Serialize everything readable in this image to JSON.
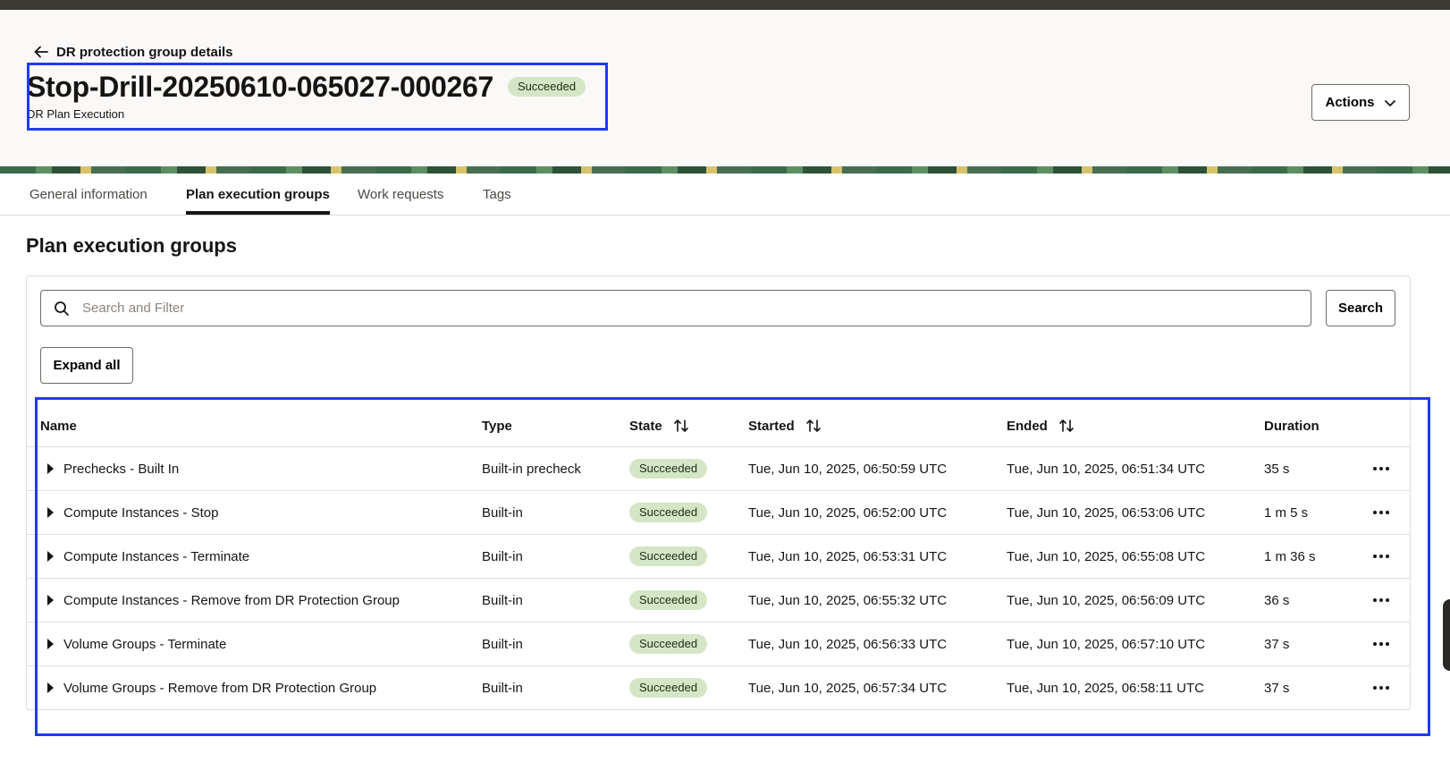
{
  "header": {
    "back_label": "DR protection group details",
    "title": "Stop-Drill-20250610-065027-000267",
    "status": "Succeeded",
    "subtitle": "DR Plan Execution",
    "actions_label": "Actions"
  },
  "tabs": [
    {
      "label": "General information",
      "active": false
    },
    {
      "label": "Plan execution groups",
      "active": true
    },
    {
      "label": "Work requests",
      "active": false
    },
    {
      "label": "Tags",
      "active": false
    }
  ],
  "section": {
    "title": "Plan execution groups"
  },
  "search": {
    "placeholder": "Search and Filter",
    "button_label": "Search"
  },
  "expand_label": "Expand all",
  "table": {
    "columns": {
      "name": "Name",
      "type": "Type",
      "state": "State",
      "started": "Started",
      "ended": "Ended",
      "duration": "Duration"
    },
    "rows": [
      {
        "name": "Prechecks - Built In",
        "type": "Built-in precheck",
        "state": "Succeeded",
        "started": "Tue, Jun 10, 2025, 06:50:59 UTC",
        "ended": "Tue, Jun 10, 2025, 06:51:34 UTC",
        "duration": "35 s"
      },
      {
        "name": "Compute Instances - Stop",
        "type": "Built-in",
        "state": "Succeeded",
        "started": "Tue, Jun 10, 2025, 06:52:00 UTC",
        "ended": "Tue, Jun 10, 2025, 06:53:06 UTC",
        "duration": "1 m 5 s"
      },
      {
        "name": "Compute Instances - Terminate",
        "type": "Built-in",
        "state": "Succeeded",
        "started": "Tue, Jun 10, 2025, 06:53:31 UTC",
        "ended": "Tue, Jun 10, 2025, 06:55:08 UTC",
        "duration": "1 m 36 s"
      },
      {
        "name": "Compute Instances - Remove from DR Protection Group",
        "type": "Built-in",
        "state": "Succeeded",
        "started": "Tue, Jun 10, 2025, 06:55:32 UTC",
        "ended": "Tue, Jun 10, 2025, 06:56:09 UTC",
        "duration": "36 s"
      },
      {
        "name": "Volume Groups - Terminate",
        "type": "Built-in",
        "state": "Succeeded",
        "started": "Tue, Jun 10, 2025, 06:56:33 UTC",
        "ended": "Tue, Jun 10, 2025, 06:57:10 UTC",
        "duration": "37 s"
      },
      {
        "name": "Volume Groups - Remove from DR Protection Group",
        "type": "Built-in",
        "state": "Succeeded",
        "started": "Tue, Jun 10, 2025, 06:57:34 UTC",
        "ended": "Tue, Jun 10, 2025, 06:58:11 UTC",
        "duration": "37 s"
      }
    ]
  },
  "colors": {
    "success_badge": "#d4e6c6",
    "highlight": "#1f3bf0",
    "text": "#161513"
  }
}
